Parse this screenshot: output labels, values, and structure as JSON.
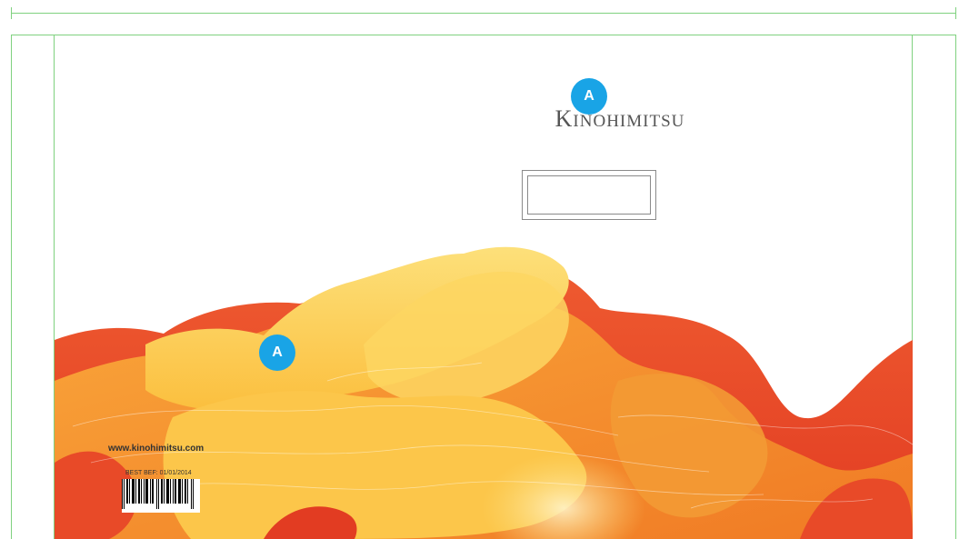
{
  "brand": {
    "initial": "K",
    "rest": "INOHIMITSU"
  },
  "markers": {
    "logo_marker": "A",
    "art_marker": "A"
  },
  "back_panel": {
    "website": "www.kinohimitsu.com",
    "best_before": "BEST BEF: 01/01/2014"
  },
  "colors": {
    "guide": "#7fd17f",
    "marker": "#19a4e6",
    "art_red": "#e8462a",
    "art_orange": "#f48a2a",
    "art_yellow": "#fcd04f"
  }
}
